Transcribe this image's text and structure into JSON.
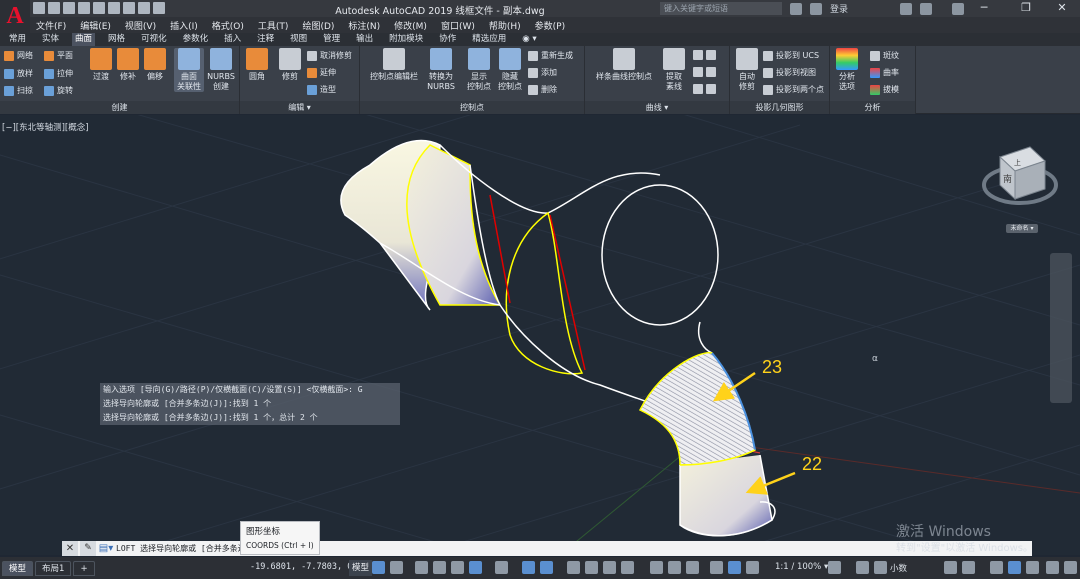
{
  "titlebar": {
    "logo": "A",
    "title": "Autodesk AutoCAD 2019    线框文件 - 副本.dwg",
    "search_placeholder": "键入关键字或短语",
    "login": "登录",
    "minimize": "─",
    "restore": "❐",
    "close": "✕"
  },
  "menubar": [
    "文件(F)",
    "编辑(E)",
    "视图(V)",
    "插入(I)",
    "格式(O)",
    "工具(T)",
    "绘图(D)",
    "标注(N)",
    "修改(M)",
    "窗口(W)",
    "帮助(H)",
    "参数(P)"
  ],
  "ribbon_tabs": [
    {
      "label": "常用",
      "active": false
    },
    {
      "label": "实体",
      "active": false
    },
    {
      "label": "曲面",
      "active": true
    },
    {
      "label": "网格",
      "active": false
    },
    {
      "label": "可视化",
      "active": false
    },
    {
      "label": "参数化",
      "active": false
    },
    {
      "label": "插入",
      "active": false
    },
    {
      "label": "注释",
      "active": false
    },
    {
      "label": "视图",
      "active": false
    },
    {
      "label": "管理",
      "active": false
    },
    {
      "label": "输出",
      "active": false
    },
    {
      "label": "附加模块",
      "active": false
    },
    {
      "label": "协作",
      "active": false
    },
    {
      "label": "精选应用",
      "active": false
    }
  ],
  "ribbon": {
    "create": {
      "label": "创建",
      "small": [
        "网络",
        "平面",
        "放样",
        "拉伸",
        "扫掠",
        "旋转"
      ],
      "big": [
        "过渡",
        "修补",
        "偏移"
      ],
      "assoc": [
        "曲面",
        "关联性"
      ],
      "nurbs": [
        "NURBS",
        "创建"
      ]
    },
    "edit": {
      "label": "编辑 ▾",
      "big": [
        "圆角",
        "修剪"
      ],
      "small": [
        "取消修剪",
        "延伸",
        "造型"
      ]
    },
    "controlpoints": {
      "label": "控制点",
      "big1": "控制点编辑栏",
      "big2": [
        "转换为",
        "NURBS"
      ],
      "big3": [
        "显示",
        "控制点"
      ],
      "big4": [
        "隐藏",
        "控制点"
      ],
      "small": [
        "重新生成",
        "添加",
        "删除"
      ]
    },
    "curves": {
      "label": "曲线 ▾",
      "big1": "样条曲线控制点",
      "big2": [
        "提取",
        "素线"
      ]
    },
    "projection": {
      "label": "投影几何图形",
      "big": [
        "自动",
        "修剪"
      ],
      "small": [
        "投影到 UCS",
        "投影到视图",
        "投影到两个点"
      ]
    },
    "analysis": {
      "label": "分析",
      "big": [
        "分析",
        "选项"
      ],
      "small": [
        "斑纹",
        "曲率",
        "拔模"
      ]
    }
  },
  "viewport": {
    "label": "[−][东北等轴测][概念]",
    "viewcube_top": "上",
    "viewcube_south": "南",
    "viewcube_label": "未命名 ▾",
    "callout_a": "23",
    "callout_b": "22",
    "cursor_glyph": "α",
    "colors": {
      "edge": "#ffffff",
      "highlight": "#ffff00",
      "section": "#e00000",
      "arrow": "#ffd21a",
      "surface_light": "#f6f4dc",
      "surface_dark": "#5b5fb0"
    }
  },
  "command": {
    "history": [
      "输入选项 [导向(G)/路径(P)/仅横截面(C)/设置(S)] <仅横截面>: G",
      "选择导向轮廓或 [合并多条边(J)]:找到 1 个",
      "选择导向轮廓或 [合并多条边(J)]:找到 1 个，总计 2 个"
    ],
    "prompt": "LOFT 选择导向轮廓或 [合并多条边(J)]:",
    "tooltip_title": "图形坐标",
    "tooltip_shortcut": "COORDS (Ctrl + I)"
  },
  "statusbar": {
    "tabs": [
      {
        "label": "模型",
        "active": true
      },
      {
        "label": "布局1",
        "active": false
      },
      {
        "label": "+",
        "active": false
      }
    ],
    "coords": "-19.6801, -7.7803, 0.0000",
    "model": "模型",
    "scale": "1:1 / 100% ▾",
    "units": "小数"
  },
  "watermark": {
    "line1": "激活 Windows",
    "line2": "转到\"设置\"以激活 Windows。"
  }
}
